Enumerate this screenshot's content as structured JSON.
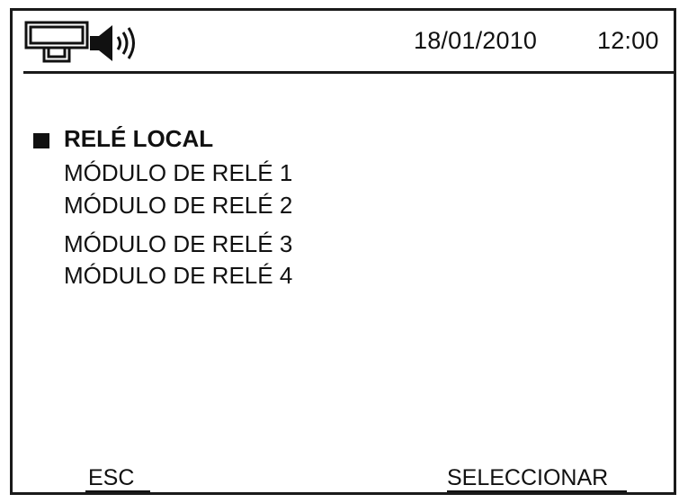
{
  "status_bar": {
    "icons": [
      "network-icon",
      "speaker-icon"
    ],
    "date": "18/01/2010",
    "time": "12:00"
  },
  "menu": {
    "items": [
      {
        "label": "RELÉ LOCAL",
        "selected": true
      },
      {
        "label": "MÓDULO DE RELÉ 1",
        "selected": false
      },
      {
        "label": "MÓDULO DE RELÉ 2",
        "selected": false
      },
      {
        "label": "MÓDULO DE RELÉ 3",
        "selected": false
      },
      {
        "label": "MÓDULO DE RELÉ 4",
        "selected": false
      }
    ]
  },
  "softkeys": {
    "left": "ESC",
    "right": "SELECCIONAR"
  },
  "colors": {
    "foreground": "#111111",
    "background": "#ffffff"
  }
}
